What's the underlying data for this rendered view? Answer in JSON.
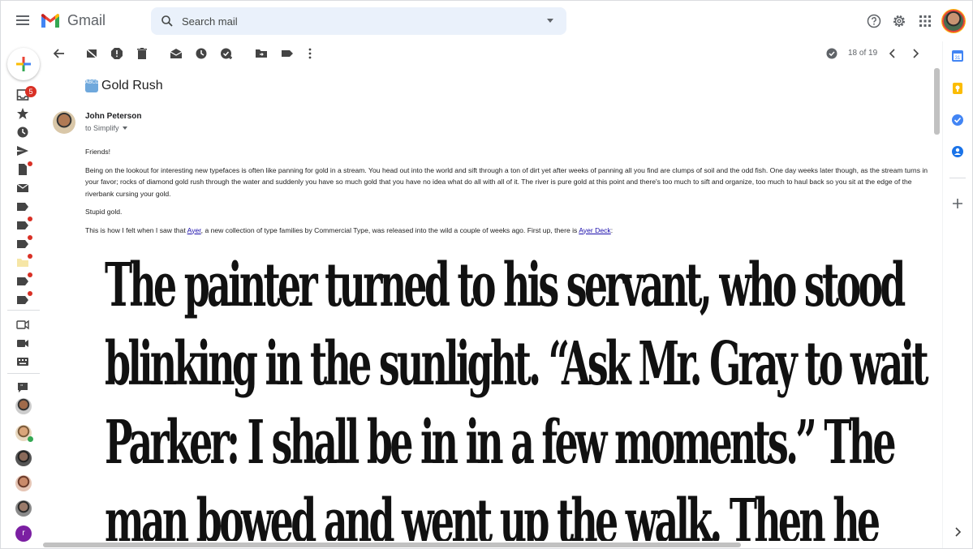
{
  "app": {
    "name": "Gmail"
  },
  "search": {
    "placeholder": "Search mail"
  },
  "rail": {
    "inbox_badge": "5"
  },
  "toolbar": {
    "pager": "18 of 19"
  },
  "message": {
    "subject": "Gold Rush",
    "subject_emoji": "ABCD",
    "sender": "John Peterson",
    "recipient": "to Simplify",
    "body": {
      "p1": "Friends!",
      "p2": "Being on the lookout for interesting new typefaces is often like panning for gold in a stream. You head out into the world and sift through a ton of dirt yet after weeks of panning all you find are clumps of soil and the odd fish. One day weeks later though, as the stream turns in your favor; rocks of diamond gold rush through the water and suddenly you have so much gold that you have no idea what do all with all of it. The river is pure gold at this point and there's too much to sift and organize, too much to haul back so you sit at the edge of the riverbank cursing your gold.",
      "p3": "Stupid gold.",
      "p4_before": "This is how I felt when I saw that ",
      "p4_link1": "Ayer",
      "p4_middle": ", a new collection of type families by Commercial Type, was released into the wild a couple of weeks ago. First up, there is ",
      "p4_link2": "Ayer Deck",
      "p4_after": ":"
    },
    "showcase_lines": [
      "The painter turned to his servant, who stood",
      "blinking in the sunlight. “Ask Mr. Gray to wait",
      "Parker: I shall be in in a few moments.” The",
      "man bowed and went up the walk. Then he"
    ]
  },
  "icons": {
    "top": [
      "hamburger-icon",
      "gmail-logo",
      "search-icon",
      "help-icon",
      "settings-icon",
      "apps-icon",
      "account-avatar"
    ],
    "toolbar": [
      "back-icon",
      "archive-icon",
      "report-spam-icon",
      "delete-icon",
      "mark-unread-icon",
      "snooze-icon",
      "add-task-icon",
      "move-to-icon",
      "label-icon",
      "more-icon",
      "check-icon",
      "prev-icon",
      "next-icon"
    ],
    "side_panel": [
      "calendar-icon",
      "keep-icon",
      "tasks-icon",
      "contacts-icon",
      "add-icon",
      "expand-icon"
    ]
  },
  "colors": {
    "search_bg": "#eaf1fb",
    "badge": "#d93025",
    "link": "#1a0dab"
  }
}
